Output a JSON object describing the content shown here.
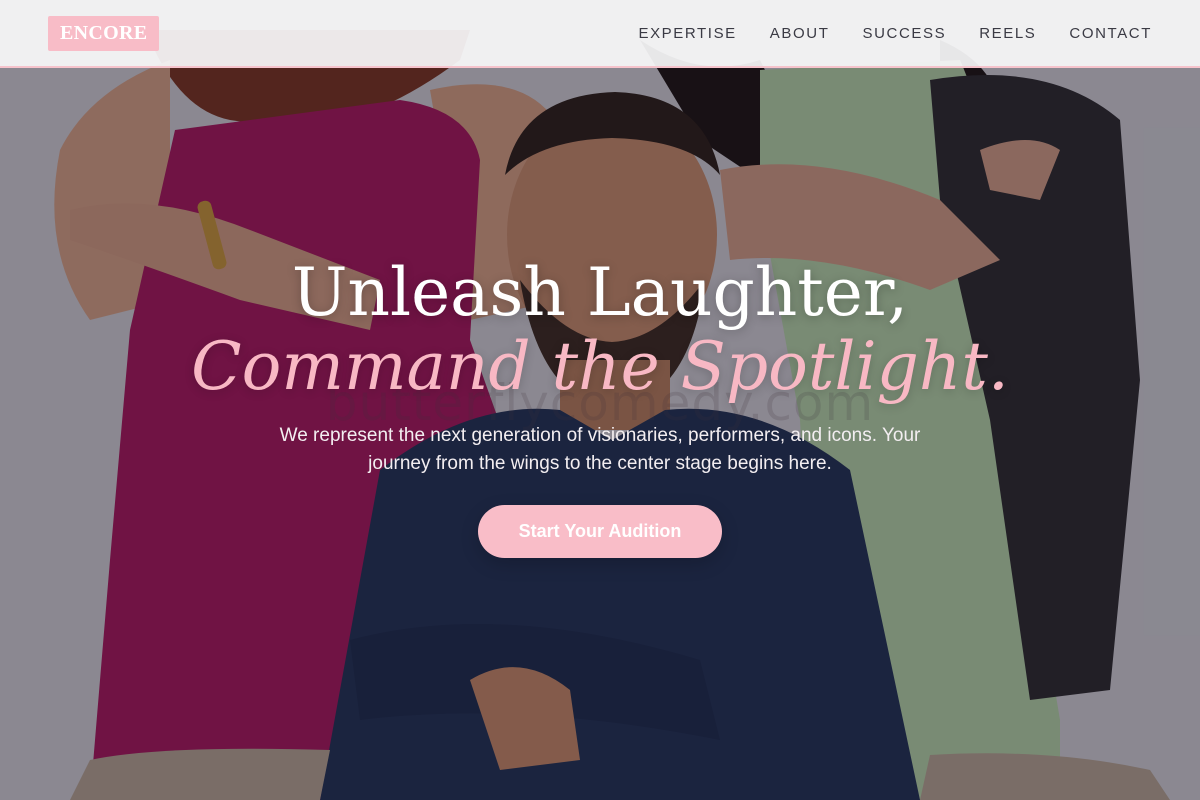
{
  "brand": {
    "logo_text": "ENCORE",
    "accent_color": "#f8bcc7"
  },
  "nav": {
    "items": [
      {
        "label": "EXPERTISE"
      },
      {
        "label": "ABOUT"
      },
      {
        "label": "SUCCESS"
      },
      {
        "label": "REELS"
      },
      {
        "label": "CONTACT"
      }
    ]
  },
  "hero": {
    "headline_line1": "Unleash Laughter,",
    "headline_line2": "Command the Spotlight.",
    "watermark": "butterflycomedy.com",
    "subtitle": "We represent the next generation of visionaries, performers, and icons. Your journey from the wings to the center stage begins here.",
    "cta_label": "Start Your Audition",
    "background_image": "group-portrait-photo"
  }
}
